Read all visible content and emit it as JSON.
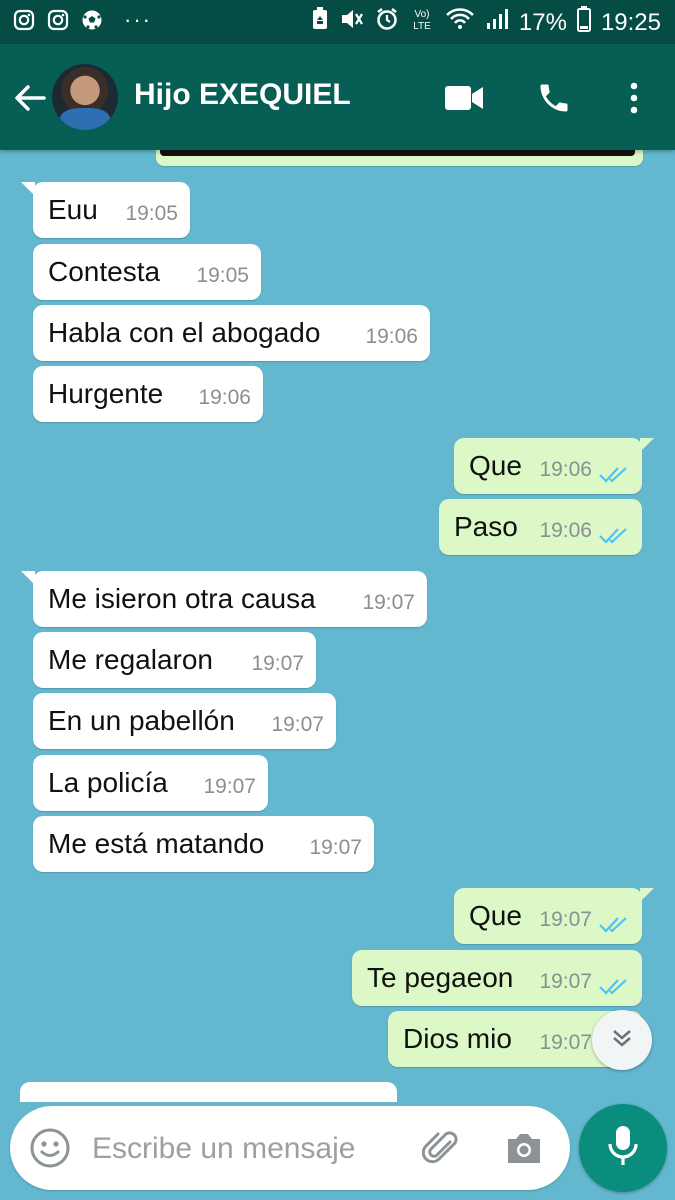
{
  "status_bar": {
    "left_icons": [
      "instagram-icon",
      "instagram-icon",
      "soccer-ball-icon"
    ],
    "more": "···",
    "right_icons": [
      "recycle-icon",
      "mute-icon",
      "alarm-icon",
      "volte-icon",
      "wifi-icon",
      "signal-icon"
    ],
    "battery": "17%",
    "time": "19:25"
  },
  "header": {
    "contact_name": "Hijo EXEQUIEL",
    "icons": [
      "back-arrow-icon",
      "avatar",
      "video-call-icon",
      "phone-icon",
      "more-vert-icon"
    ]
  },
  "messages": [
    {
      "dir": "in",
      "text": "Euu",
      "time": "19:05"
    },
    {
      "dir": "in",
      "text": "Contesta",
      "time": "19:05"
    },
    {
      "dir": "in",
      "text": "Habla con el abogado",
      "time": "19:06"
    },
    {
      "dir": "in",
      "text": "Hurgente",
      "time": "19:06"
    },
    {
      "dir": "out",
      "text": "Que",
      "time": "19:06",
      "read": true
    },
    {
      "dir": "out",
      "text": "Paso",
      "time": "19:06",
      "read": true
    },
    {
      "dir": "in",
      "text": "Me isieron otra causa",
      "time": "19:07"
    },
    {
      "dir": "in",
      "text": "Me regalaron",
      "time": "19:07"
    },
    {
      "dir": "in",
      "text": "En un pabellón",
      "time": "19:07"
    },
    {
      "dir": "in",
      "text": "La policía",
      "time": "19:07"
    },
    {
      "dir": "in",
      "text": "Me está matando",
      "time": "19:07"
    },
    {
      "dir": "out",
      "text": "Que",
      "time": "19:07",
      "read": true
    },
    {
      "dir": "out",
      "text": "Te pegaeon",
      "time": "19:07",
      "read": true
    },
    {
      "dir": "out",
      "text": "Dios mio",
      "time": "19:07",
      "read": true
    }
  ],
  "composer": {
    "placeholder": "Escribe un mensaje"
  },
  "colors": {
    "header": "#075e54",
    "status_bar": "#054d44",
    "chat_background": "#63b8cf",
    "incoming_bubble": "#ffffff",
    "outgoing_bubble": "#dcf8c6",
    "read_ticks": "#4fc3f7",
    "mic_button": "#0a8d7c"
  }
}
